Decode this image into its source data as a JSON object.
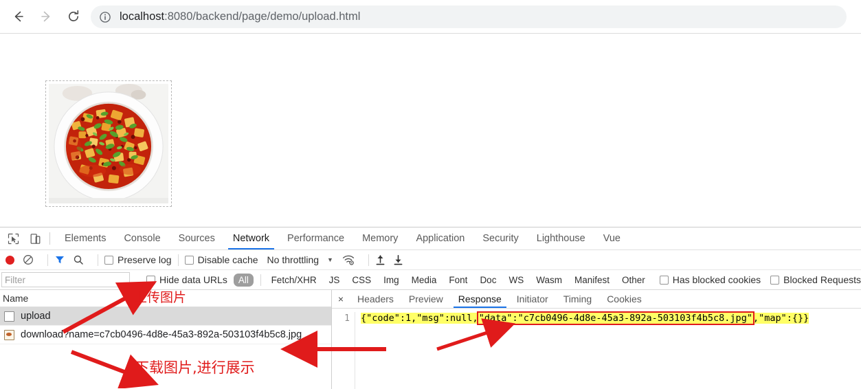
{
  "browser": {
    "back_icon": "arrow-left-icon",
    "forward_icon": "arrow-right-icon",
    "reload_icon": "reload-icon",
    "site_info_icon": "info-circle-icon",
    "url_host": "localhost",
    "url_path": ":8080/backend/page/demo/upload.html",
    "url_full": "localhost:8080/backend/page/demo/upload.html"
  },
  "page": {
    "upload_box_label": "image-upload-dropzone",
    "image_alt": "mapo-tofu-dish-photo"
  },
  "devtools": {
    "tool_icons": [
      {
        "name": "inspect-element-icon"
      },
      {
        "name": "device-toolbar-icon"
      }
    ],
    "tabs": [
      {
        "label": "Elements",
        "active": false
      },
      {
        "label": "Console",
        "active": false
      },
      {
        "label": "Sources",
        "active": false
      },
      {
        "label": "Network",
        "active": true
      },
      {
        "label": "Performance",
        "active": false
      },
      {
        "label": "Memory",
        "active": false
      },
      {
        "label": "Application",
        "active": false
      },
      {
        "label": "Security",
        "active": false
      },
      {
        "label": "Lighthouse",
        "active": false
      },
      {
        "label": "Vue",
        "active": false
      }
    ],
    "toolbar": {
      "record_icon": "record-stop-icon",
      "clear_icon": "clear-circle-slash-icon",
      "filter_icon": "funnel-filter-icon",
      "search_icon": "search-magnifier-icon",
      "preserve_log_label": "Preserve log",
      "preserve_log_checked": false,
      "disable_cache_label": "Disable cache",
      "disable_cache_checked": false,
      "throttling_value": "No throttling",
      "throttling_caret": "▼",
      "wifi_icon": "network-conditions-wifi-icon",
      "import_icon": "import-har-up-arrow-icon",
      "export_icon": "export-har-down-arrow-icon"
    },
    "filter_bar": {
      "filter_placeholder": "Filter",
      "filter_value": "",
      "hide_data_urls_label": "Hide data URLs",
      "hide_data_urls_checked": false,
      "type_filters": [
        {
          "label": "All",
          "selected": true
        },
        {
          "label": "Fetch/XHR",
          "selected": false
        },
        {
          "label": "JS",
          "selected": false
        },
        {
          "label": "CSS",
          "selected": false
        },
        {
          "label": "Img",
          "selected": false
        },
        {
          "label": "Media",
          "selected": false
        },
        {
          "label": "Font",
          "selected": false
        },
        {
          "label": "Doc",
          "selected": false
        },
        {
          "label": "WS",
          "selected": false
        },
        {
          "label": "Wasm",
          "selected": false
        },
        {
          "label": "Manifest",
          "selected": false
        },
        {
          "label": "Other",
          "selected": false
        }
      ],
      "has_blocked_cookies_label": "Has blocked cookies",
      "has_blocked_cookies_checked": false,
      "blocked_requests_label": "Blocked Requests",
      "blocked_requests_checked": false
    },
    "request_list": {
      "column_header": "Name",
      "rows": [
        {
          "name": "upload",
          "icon": "document-file-icon",
          "selected": true
        },
        {
          "name": "download?name=c7cb0496-4d8e-45a3-892a-503103f4b5c8.jpg",
          "icon": "image-file-icon",
          "selected": false
        }
      ]
    },
    "detail_pane": {
      "close_icon": "×",
      "tabs": [
        {
          "label": "Headers",
          "active": false
        },
        {
          "label": "Preview",
          "active": false
        },
        {
          "label": "Response",
          "active": true
        },
        {
          "label": "Initiator",
          "active": false
        },
        {
          "label": "Timing",
          "active": false
        },
        {
          "label": "Cookies",
          "active": false
        }
      ],
      "response": {
        "line_number": "1",
        "raw": "{\"code\":1,\"msg\":null,\"data\":\"c7cb0496-4d8e-45a3-892a-503103f4b5c8.jpg\",\"map\":{}}",
        "segment_open": "{\"code\":1,\"msg\":null,",
        "segment_highlight": "\"data\":\"c7cb0496-4d8e-45a3-892a-503103f4b5c8.jpg\"",
        "segment_close": ",\"map\":{}}",
        "code_value": "1",
        "msg_value": "null",
        "data_value": "c7cb0496-4d8e-45a3-892a-503103f4b5c8.jpg",
        "map_value": "{}"
      }
    }
  },
  "annotations": {
    "accent_color": "#e01b1b",
    "upload_note": "上传图片",
    "download_note": "下载图片,进行展示",
    "arrows": [
      {
        "name": "arrow-to-upload-row"
      },
      {
        "name": "arrow-to-download-row-from-right"
      },
      {
        "name": "arrow-to-download-note"
      },
      {
        "name": "arrow-to-data-field"
      }
    ]
  }
}
